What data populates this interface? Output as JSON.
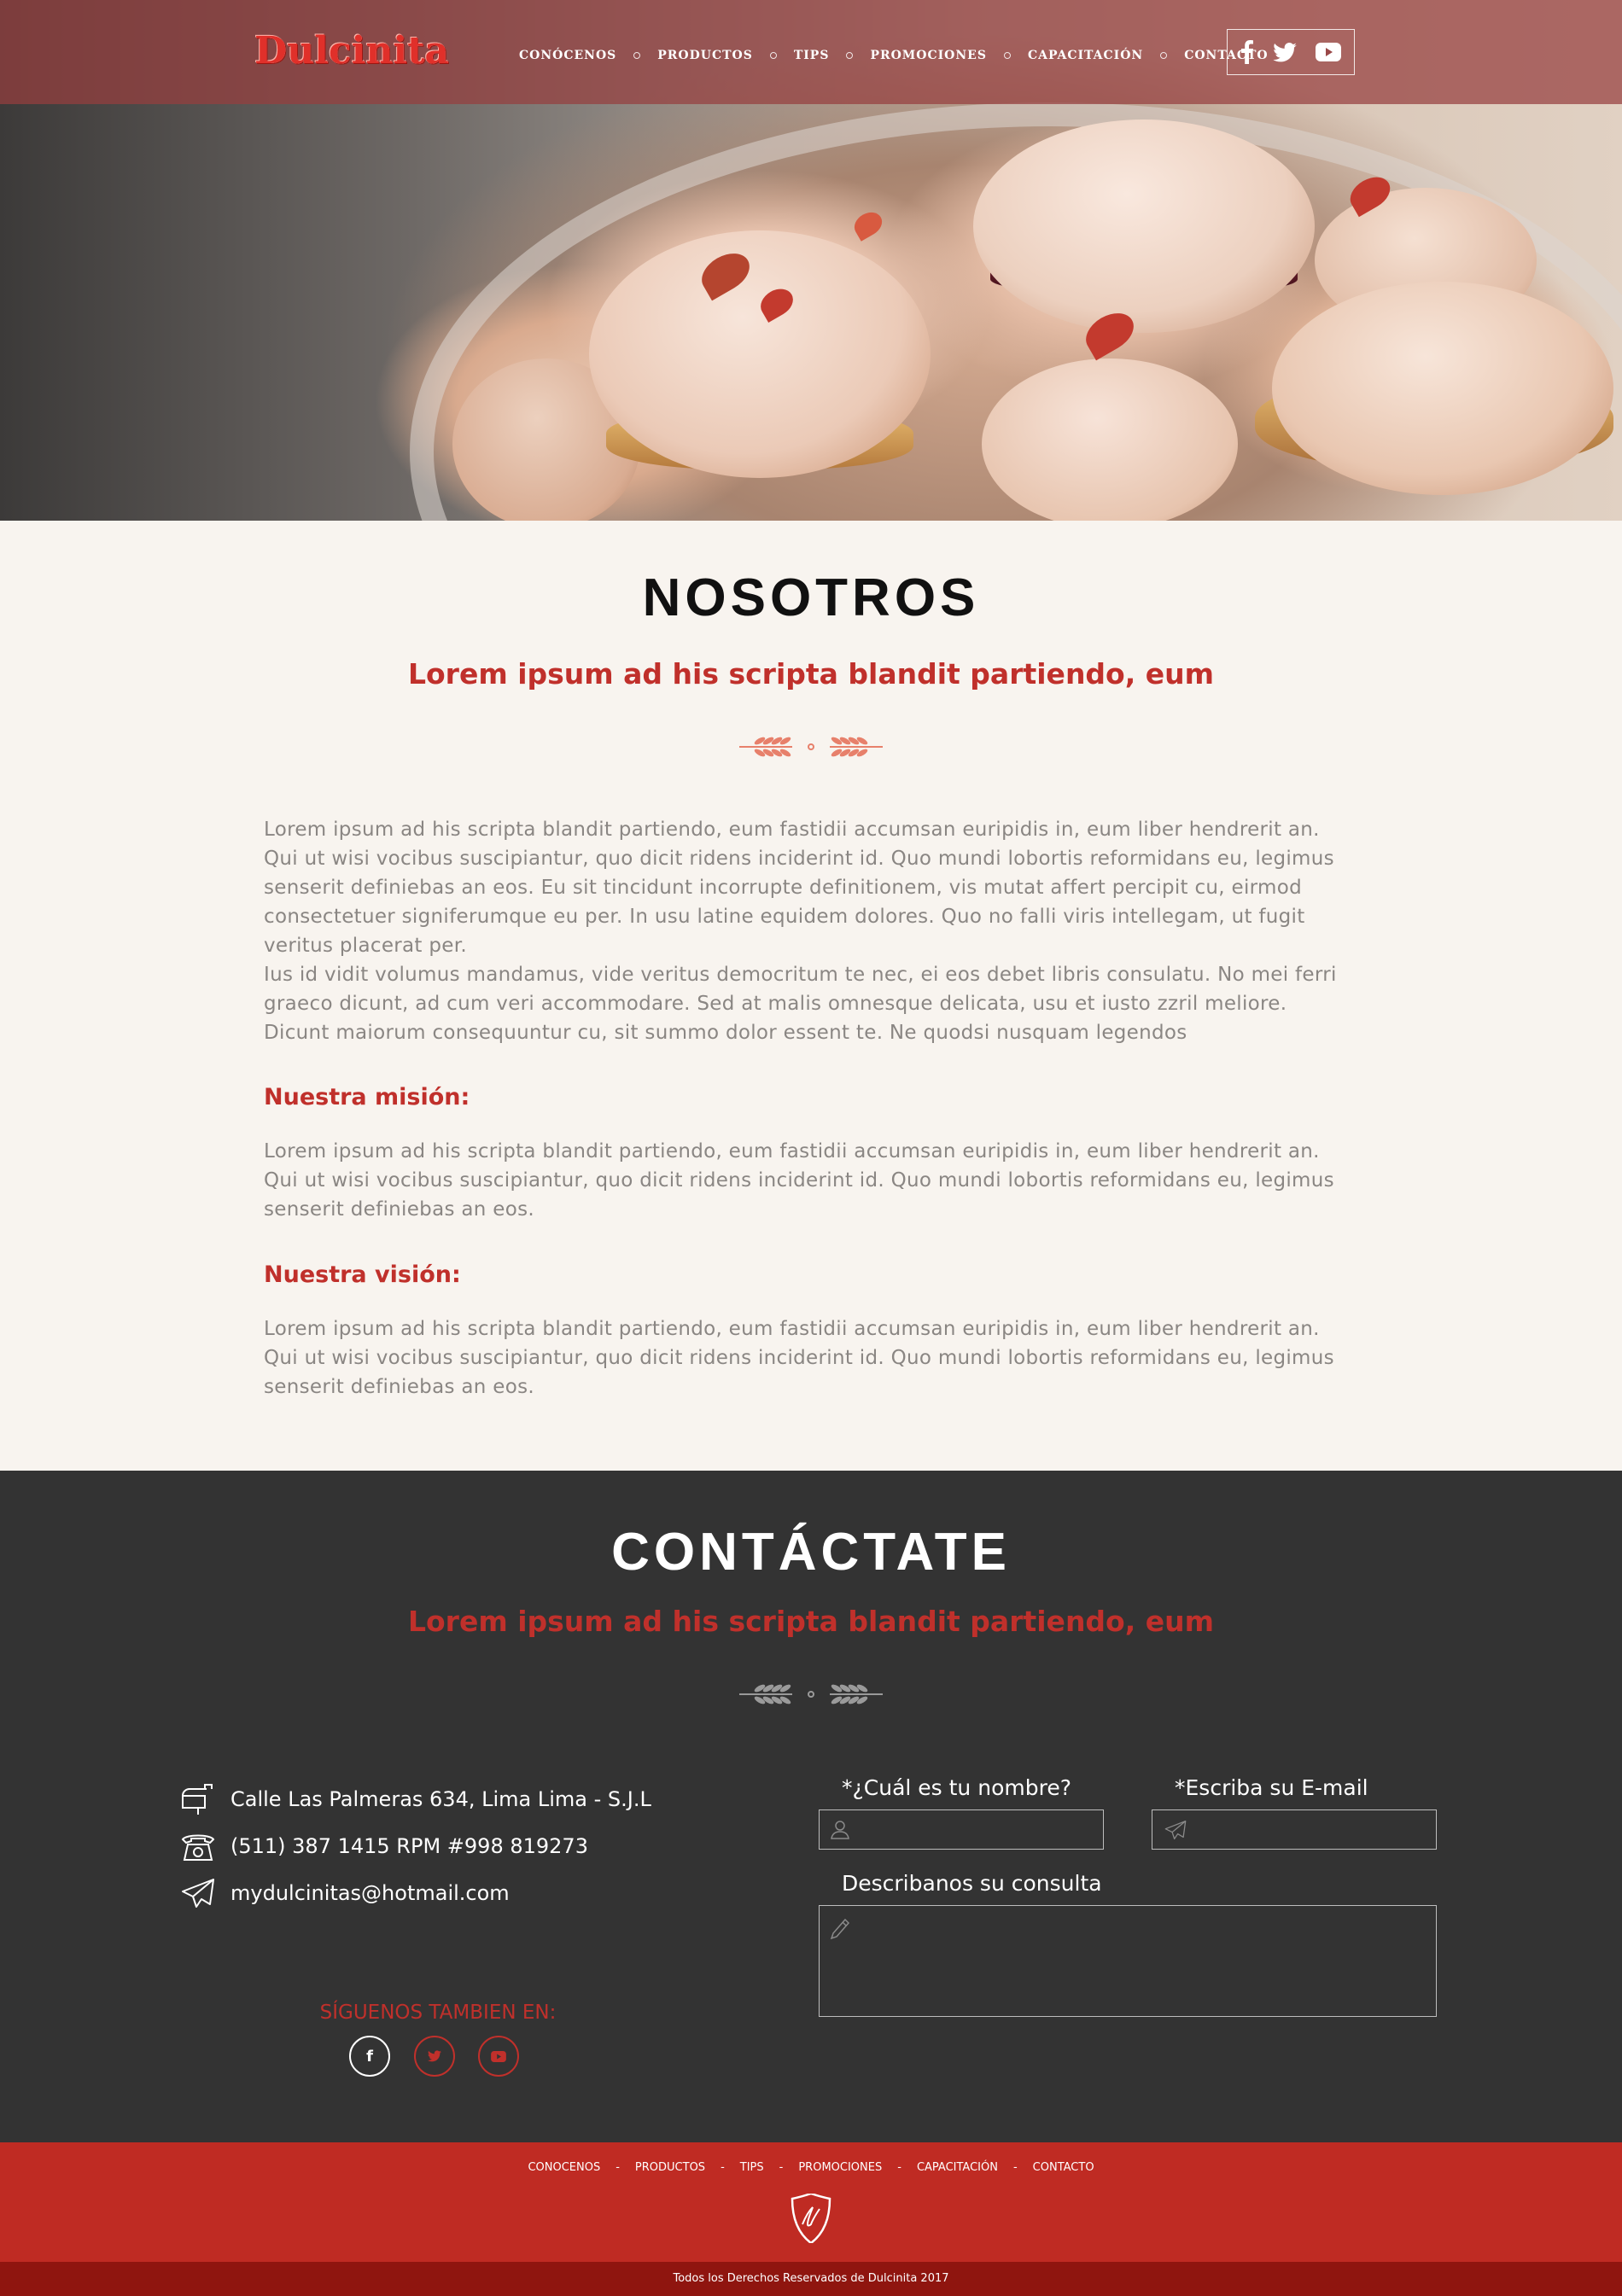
{
  "header": {
    "logo": "Dulcinita",
    "nav": [
      "CONÓCENOS",
      "PRODUCTOS",
      "TIPS",
      "PROMOCIONES",
      "CAPACITACIÓN",
      "CONTACTO"
    ],
    "social": [
      "facebook-icon",
      "twitter-icon",
      "youtube-icon"
    ]
  },
  "about": {
    "title": "NOSOTROS",
    "subtitle": "Lorem ipsum ad his scripta blandit partiendo, eum",
    "paragraph1": "Lorem ipsum ad his scripta blandit partiendo, eum fastidii accumsan euripidis in, eum liber hendrerit an. Qui ut wisi vocibus suscipiantur, quo dicit ridens inciderint id. Quo mundi lobortis reformidans eu, legimus senserit definiebas an eos. Eu sit tincidunt incorrupte definitionem, vis mutat affert percipit cu, eirmod consectetuer signiferumque eu per. In usu latine equidem dolores. Quo no falli viris intellegam, ut fugit veritus placerat per.",
    "paragraph2": "Ius id vidit volumus mandamus, vide veritus democritum te nec, ei eos debet libris consulatu. No mei ferri graeco dicunt, ad cum veri accommodare. Sed at malis omnesque delicata, usu et iusto zzril meliore. Dicunt maiorum consequuntur cu, sit summo dolor essent te. Ne quodsi nusquam legendos",
    "mission_title": "Nuestra misión:",
    "mission_text": "Lorem ipsum ad his scripta blandit partiendo, eum fastidii accumsan euripidis in, eum liber hendrerit an. Qui ut wisi vocibus suscipiantur, quo dicit ridens inciderint id. Quo mundi lobortis reformidans eu, legimus senserit definiebas an eos.",
    "vision_title": "Nuestra visión:",
    "vision_text": "Lorem ipsum ad his scripta blandit partiendo, eum fastidii accumsan euripidis in, eum liber hendrerit an. Qui ut wisi vocibus suscipiantur, quo dicit ridens inciderint id. Quo mundi lobortis reformidans eu, legimus senserit definiebas an eos."
  },
  "contact": {
    "title": "CONTÁCTATE",
    "subtitle": "Lorem ipsum ad his scripta blandit partiendo, eum",
    "address": "Calle Las Palmeras 634, Lima Lima - S.J.L",
    "phone": "(511) 387 1415 RPM #998 819273",
    "email": "mydulcinitas@hotmail.com",
    "follow_label": "SÍGUENOS TAMBIEN EN:",
    "follow_icons": [
      "f",
      "t",
      "yt"
    ],
    "form": {
      "name_label": "*¿Cuál es tu nombre?",
      "email_label": "*Escriba su E-mail",
      "message_label": "Describanos su consulta",
      "name_value": "",
      "email_value": "",
      "message_value": ""
    }
  },
  "footer": {
    "nav": [
      "CONOCENOS",
      "PRODUCTOS",
      "TIPS",
      "PROMOCIONES",
      "CAPACITACIÓN",
      "CONTACTO"
    ],
    "separator": "-",
    "copyright": "Todos los Derechos Reservados de Dulcinita 2017"
  },
  "colors": {
    "brand_red": "#c0302b",
    "dark_bg": "#333333",
    "footer_red": "#bf2b23",
    "footer_dark": "#8f150f",
    "cream": "#f8f4ef"
  }
}
